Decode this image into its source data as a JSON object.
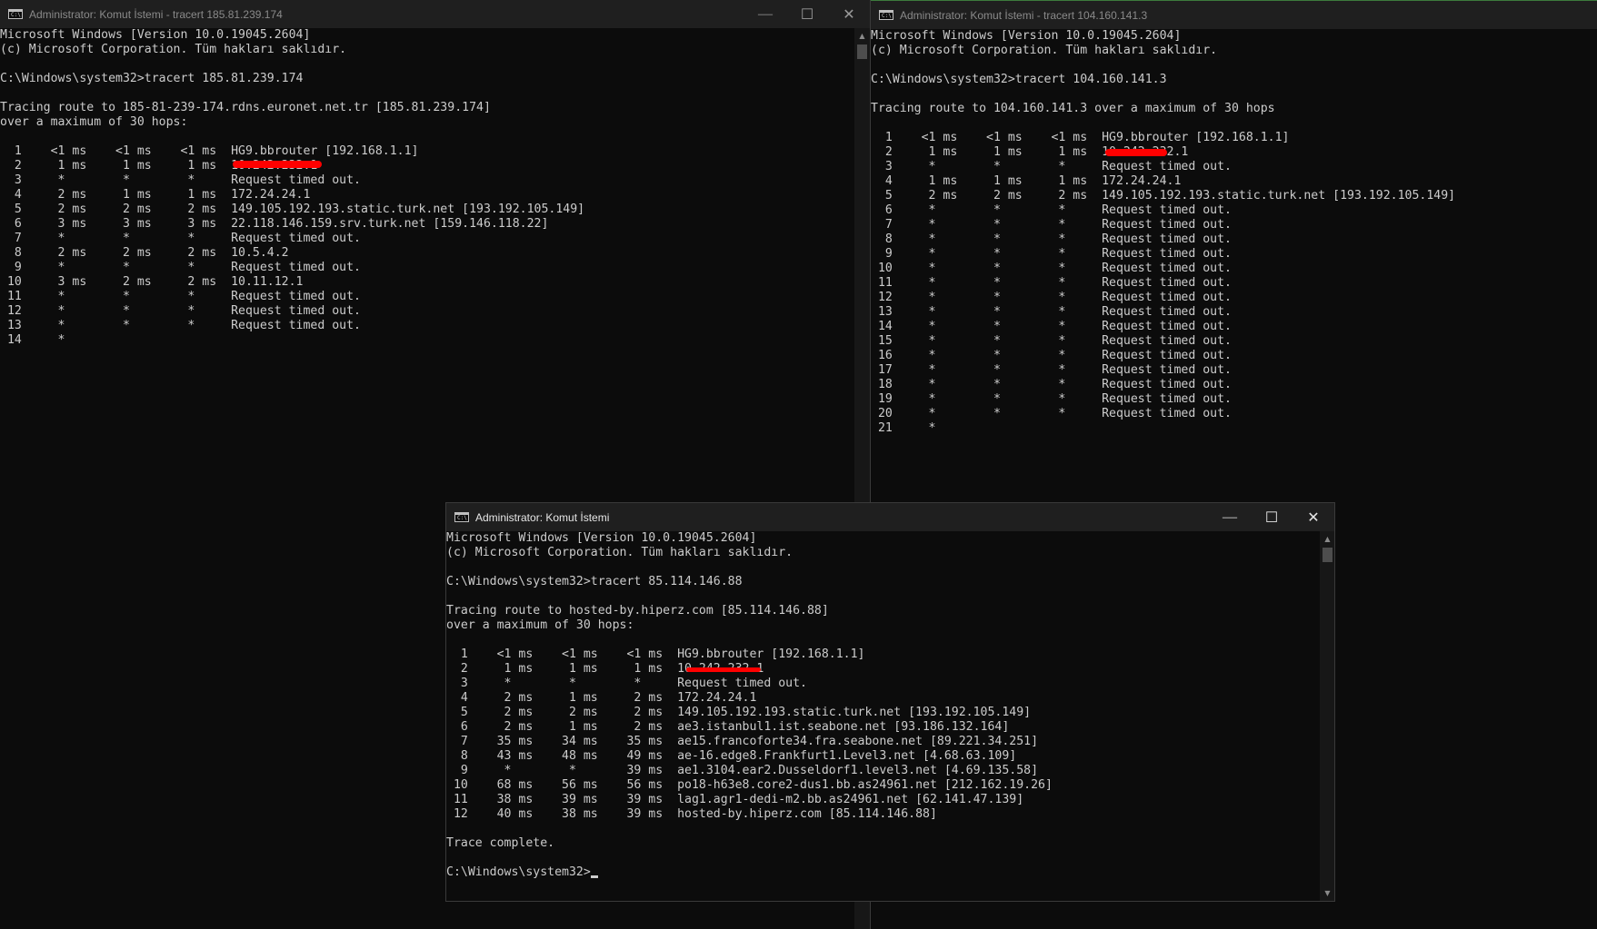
{
  "windows": {
    "left": {
      "title": "Administrator: Komut İstemi - tracert  185.81.239.174",
      "lines": [
        "Microsoft Windows [Version 10.0.19045.2604]",
        "(c) Microsoft Corporation. Tüm hakları saklıdır.",
        "",
        "C:\\Windows\\system32>tracert 185.81.239.174",
        "",
        "Tracing route to 185-81-239-174.rdns.euronet.net.tr [185.81.239.174]",
        "over a maximum of 30 hops:",
        "",
        "  1    <1 ms    <1 ms    <1 ms  HG9.bbrouter [192.168.1.1]",
        "  2     1 ms     1 ms     1 ms  10.242.232.1",
        "  3     *        *        *     Request timed out.",
        "  4     2 ms     1 ms     1 ms  172.24.24.1",
        "  5     2 ms     2 ms     2 ms  149.105.192.193.static.turk.net [193.192.105.149]",
        "  6     3 ms     3 ms     3 ms  22.118.146.159.srv.turk.net [159.146.118.22]",
        "  7     *        *        *     Request timed out.",
        "  8     2 ms     2 ms     2 ms  10.5.4.2",
        "  9     *        *        *     Request timed out.",
        " 10     3 ms     2 ms     2 ms  10.11.12.1",
        " 11     *        *        *     Request timed out.",
        " 12     *        *        *     Request timed out.",
        " 13     *        *        *     Request timed out.",
        " 14     *"
      ]
    },
    "right": {
      "title": "Administrator: Komut İstemi - tracert  104.160.141.3",
      "lines": [
        "Microsoft Windows [Version 10.0.19045.2604]",
        "(c) Microsoft Corporation. Tüm hakları saklıdır.",
        "",
        "C:\\Windows\\system32>tracert 104.160.141.3",
        "",
        "Tracing route to 104.160.141.3 over a maximum of 30 hops",
        "",
        "  1    <1 ms    <1 ms    <1 ms  HG9.bbrouter [192.168.1.1]",
        "  2     1 ms     1 ms     1 ms  10.242.232.1",
        "  3     *        *        *     Request timed out.",
        "  4     1 ms     1 ms     1 ms  172.24.24.1",
        "  5     2 ms     2 ms     2 ms  149.105.192.193.static.turk.net [193.192.105.149]",
        "  6     *        *        *     Request timed out.",
        "  7     *        *        *     Request timed out.",
        "  8     *        *        *     Request timed out.",
        "  9     *        *        *     Request timed out.",
        " 10     *        *        *     Request timed out.",
        " 11     *        *        *     Request timed out.",
        " 12     *        *        *     Request timed out.",
        " 13     *        *        *     Request timed out.",
        " 14     *        *        *     Request timed out.",
        " 15     *        *        *     Request timed out.",
        " 16     *        *        *     Request timed out.",
        " 17     *        *        *     Request timed out.",
        " 18     *        *        *     Request timed out.",
        " 19     *        *        *     Request timed out.",
        " 20     *        *        *     Request timed out.",
        " 21     *"
      ]
    },
    "front": {
      "title": "Administrator: Komut İstemi",
      "lines": [
        "Microsoft Windows [Version 10.0.19045.2604]",
        "(c) Microsoft Corporation. Tüm hakları saklıdır.",
        "",
        "C:\\Windows\\system32>tracert 85.114.146.88",
        "",
        "Tracing route to hosted-by.hiperz.com [85.114.146.88]",
        "over a maximum of 30 hops:",
        "",
        "  1    <1 ms    <1 ms    <1 ms  HG9.bbrouter [192.168.1.1]",
        "  2     1 ms     1 ms     1 ms  10.242.232.1",
        "  3     *        *        *     Request timed out.",
        "  4     2 ms     1 ms     2 ms  172.24.24.1",
        "  5     2 ms     2 ms     2 ms  149.105.192.193.static.turk.net [193.192.105.149]",
        "  6     2 ms     1 ms     2 ms  ae3.istanbul1.ist.seabone.net [93.186.132.164]",
        "  7    35 ms    34 ms    35 ms  ae15.francoforte34.fra.seabone.net [89.221.34.251]",
        "  8    43 ms    48 ms    49 ms  ae-16.edge8.Frankfurt1.Level3.net [4.68.63.109]",
        "  9     *        *       39 ms  ae1.3104.ear2.Dusseldorf1.level3.net [4.69.135.58]",
        " 10    68 ms    56 ms    56 ms  po18-h63e8.core2-dus1.bb.as24961.net [212.162.19.26]",
        " 11    38 ms    39 ms    39 ms  lag1.agr1-dedi-m2.bb.as24961.net [62.141.47.139]",
        " 12    40 ms    38 ms    39 ms  hosted-by.hiperz.com [85.114.146.88]",
        "",
        "Trace complete.",
        "",
        "C:\\Windows\\system32>"
      ]
    }
  },
  "controls": {
    "minimize": "—",
    "maximize": "☐",
    "close": "✕"
  },
  "colors": {
    "titlebar_inactive": "#1f1f1f",
    "titlebar_active": "#1f1f1f",
    "text": "#cccccc",
    "redaction": "#ff0000",
    "accent_border": "#3c7a3c"
  }
}
